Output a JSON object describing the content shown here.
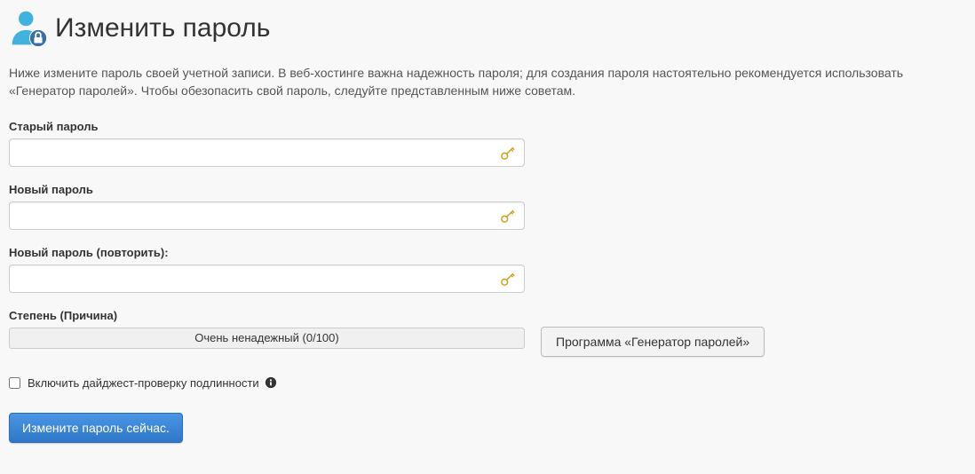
{
  "header": {
    "title": "Изменить пароль"
  },
  "description": "Ниже измените пароль своей учетной записи. В веб-хостинге важна надежность пароля; для создания пароля настоятельно рекомендуется использовать «Генератор паролей». Чтобы обезопасить свой пароль, следуйте представленным ниже советам.",
  "form": {
    "old_password": {
      "label": "Старый пароль",
      "value": ""
    },
    "new_password": {
      "label": "Новый пароль",
      "value": ""
    },
    "confirm_password": {
      "label": "Новый пароль (повторить):",
      "value": ""
    },
    "strength": {
      "label": "Степень (Причина)",
      "text": "Очень ненадежный (0/100)"
    },
    "generator_button": "Программа «Генератор паролей»",
    "digest_checkbox": {
      "label": "Включить дайджест-проверку подлинности",
      "checked": false
    },
    "submit_button": "Измените пароль сейчас."
  }
}
